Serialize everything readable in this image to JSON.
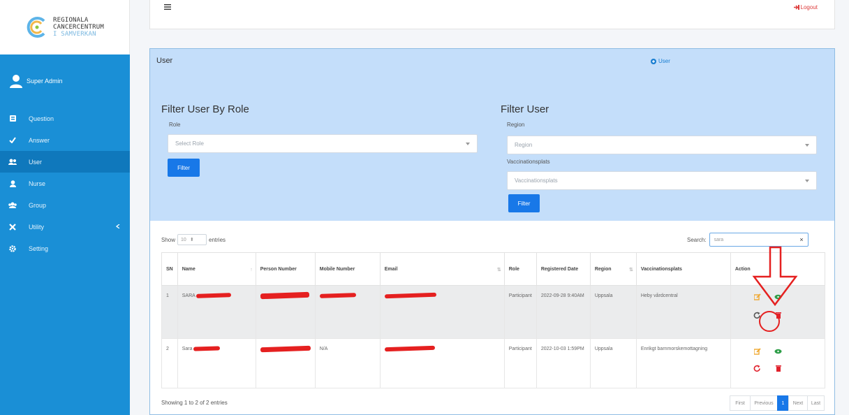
{
  "brand": {
    "line1": "REGIONALA",
    "line2": "CANCERCENTRUM",
    "line3": "I SAMVERKAN"
  },
  "sidebar": {
    "user": "Super Admin",
    "items": [
      {
        "label": "Question",
        "icon": "square-icon"
      },
      {
        "label": "Answer",
        "icon": "check-icon"
      },
      {
        "label": "User",
        "icon": "users-icon",
        "active": true
      },
      {
        "label": "Nurse",
        "icon": "user-icon"
      },
      {
        "label": "Group",
        "icon": "group-icon"
      },
      {
        "label": "Utility",
        "icon": "tools-icon"
      },
      {
        "label": "Setting",
        "icon": "gear-icon"
      }
    ]
  },
  "topbar": {
    "logout": "Logout"
  },
  "card": {
    "title": "User",
    "add_user": "User",
    "filter_role": {
      "heading": "Filter User By Role",
      "role_label": "Role",
      "role_placeholder": "Select Role",
      "button": "Filter"
    },
    "filter_user": {
      "heading": "Filter User",
      "region_label": "Region",
      "region_placeholder": "Region",
      "vacc_label": "Vaccinationsplats",
      "vacc_placeholder": "Vaccinationsplats",
      "button": "Filter"
    }
  },
  "table_controls": {
    "show": "Show",
    "entries_value": "10",
    "entries": "entries",
    "search_label": "Search:",
    "search_value": "sara"
  },
  "table": {
    "headers": [
      "SN",
      "Name",
      "Person Number",
      "Mobile Number",
      "Email",
      "Role",
      "Registered Date",
      "Region",
      "Vaccinationsplats",
      "Action"
    ],
    "rows": [
      {
        "sn": "1",
        "name": "SARA",
        "mobile": "",
        "role": "Participant",
        "date": "2022-09-28 9:40AM",
        "region": "Uppsala",
        "vacc": "Heby vårdcentral"
      },
      {
        "sn": "2",
        "name": "Sara",
        "mobile": "N/A",
        "role": "Participant",
        "date": "2022-10-03 1:59PM",
        "region": "Uppsala",
        "vacc": "Enrikgt barnmorskemottagning"
      }
    ]
  },
  "footer": {
    "info": "Showing 1 to 2 of 2 entries",
    "pages": [
      "First",
      "Previous",
      "1",
      "Next",
      "Last"
    ]
  },
  "colors": {
    "sidebar": "#1a8fd6",
    "filter_bg": "#c4defa",
    "primary": "#1878e8",
    "annotation": "#e52020"
  }
}
